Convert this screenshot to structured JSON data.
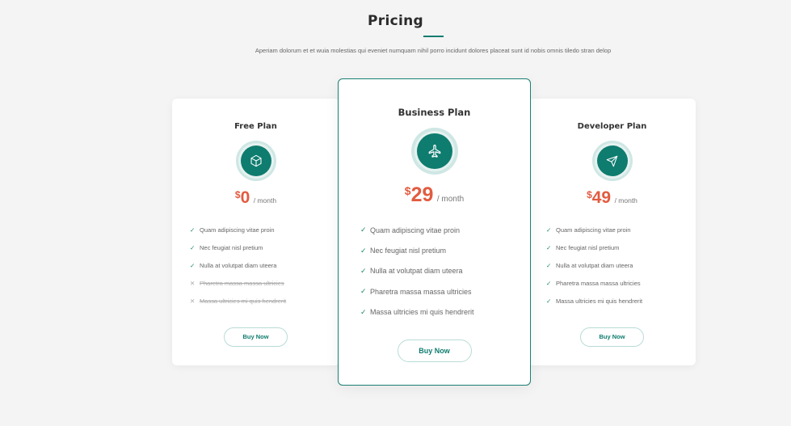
{
  "section": {
    "title": "Pricing",
    "description": "Aperiam dolorum et et wuia molestias qui eveniet numquam nihil porro incidunt dolores placeat sunt id nobis omnis tiledo stran delop"
  },
  "colors": {
    "accent": "#0e7c6f",
    "price": "#e25b3f",
    "check": "#1a8a5e",
    "background": "#f4f4f4"
  },
  "plans": [
    {
      "name": "Free Plan",
      "icon": "box-icon",
      "currency": "$",
      "amount": "0",
      "period": "/ month",
      "features": [
        {
          "text": "Quam adipiscing vitae proin",
          "included": true
        },
        {
          "text": "Nec feugiat nisl pretium",
          "included": true
        },
        {
          "text": "Nulla at volutpat diam uteera",
          "included": true
        },
        {
          "text": "Pharetra massa massa ultricies",
          "included": false
        },
        {
          "text": "Massa ultricies mi quis hendrerit",
          "included": false
        }
      ],
      "button": "Buy Now"
    },
    {
      "name": "Business Plan",
      "icon": "airplane-icon",
      "currency": "$",
      "amount": "29",
      "period": "/ month",
      "features": [
        {
          "text": "Quam adipiscing vitae proin",
          "included": true
        },
        {
          "text": "Nec feugiat nisl pretium",
          "included": true
        },
        {
          "text": "Nulla at volutpat diam uteera",
          "included": true
        },
        {
          "text": "Pharetra massa massa ultricies",
          "included": true
        },
        {
          "text": "Massa ultricies mi quis hendrerit",
          "included": true
        }
      ],
      "button": "Buy Now"
    },
    {
      "name": "Developer Plan",
      "icon": "send-icon",
      "currency": "$",
      "amount": "49",
      "period": "/ month",
      "features": [
        {
          "text": "Quam adipiscing vitae proin",
          "included": true
        },
        {
          "text": "Nec feugiat nisl pretium",
          "included": true
        },
        {
          "text": "Nulla at volutpat diam uteera",
          "included": true
        },
        {
          "text": "Pharetra massa massa ultricies",
          "included": true
        },
        {
          "text": "Massa ultricies mi quis hendrerit",
          "included": true
        }
      ],
      "button": "Buy Now"
    }
  ]
}
